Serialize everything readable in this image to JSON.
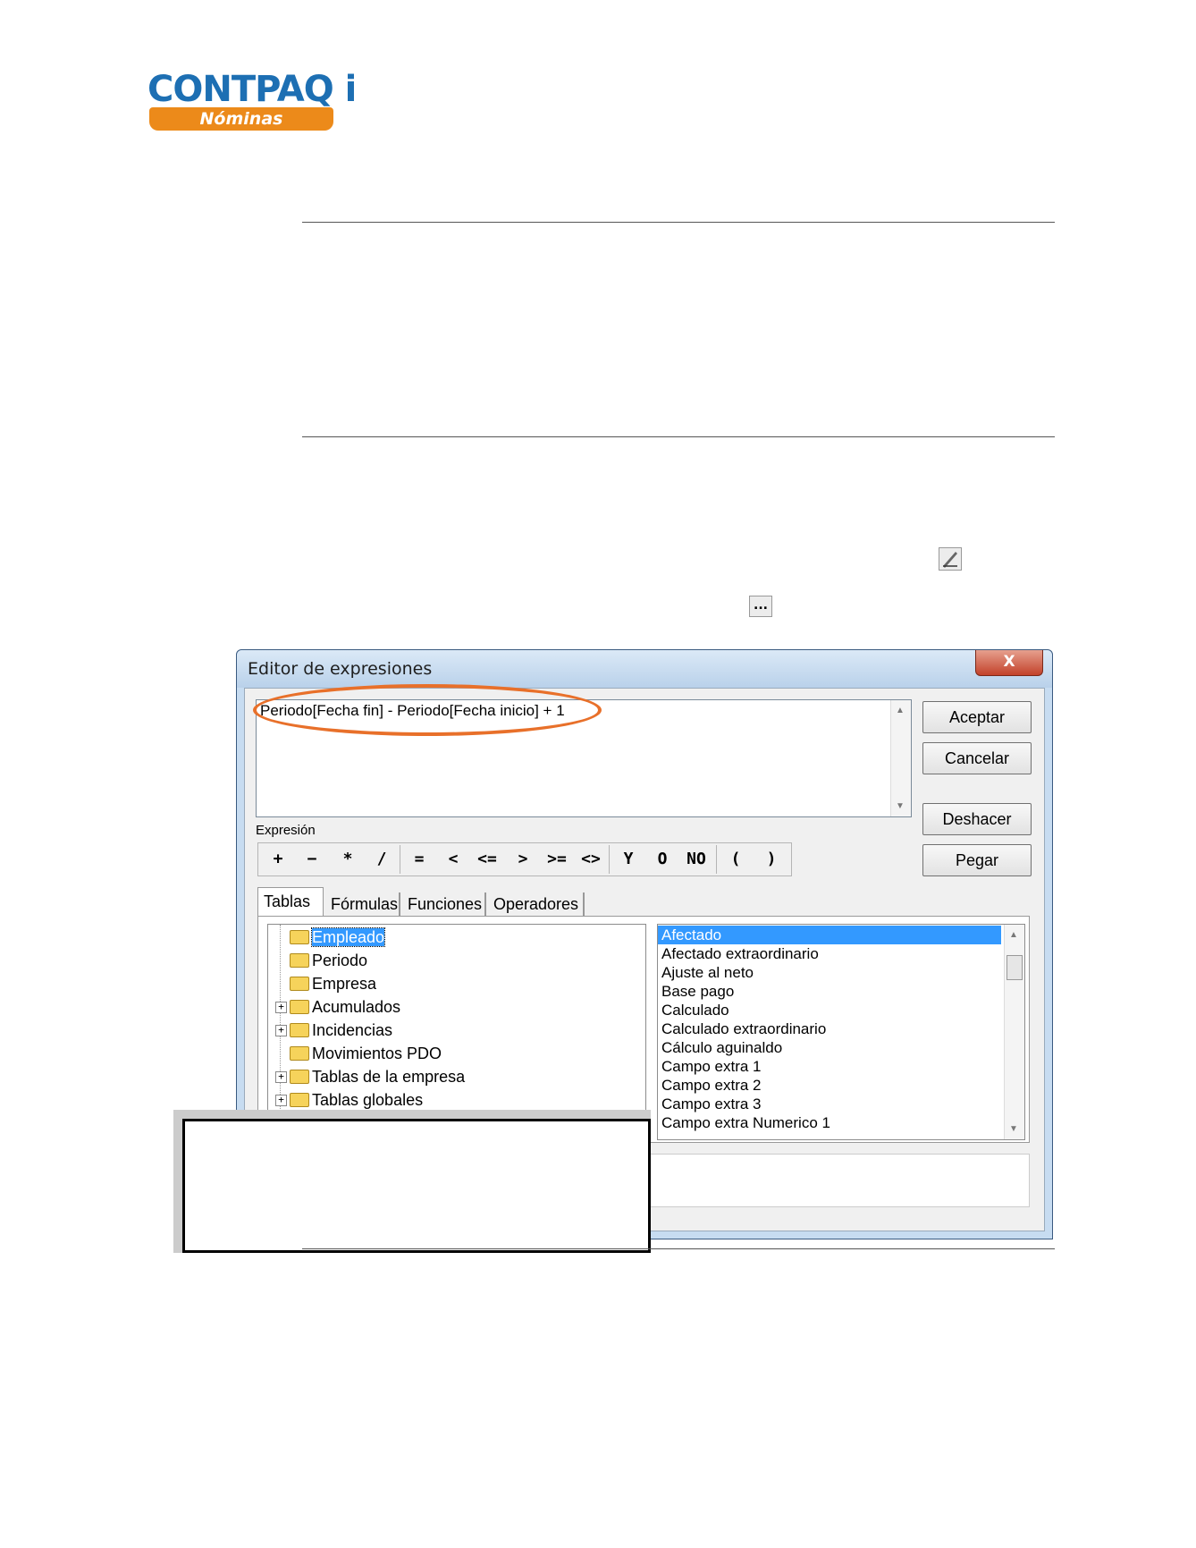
{
  "logo": {
    "word": "CONTPAQ i",
    "badge": "Nóminas"
  },
  "dialog": {
    "title": "Editor de expresiones",
    "close_glyph": "X",
    "expression": "Periodo[Fecha fin] - Periodo[Fecha inicio] + 1",
    "expression_label": "Expresión",
    "buttons": {
      "accept": "Aceptar",
      "cancel": "Cancelar",
      "undo": "Deshacer",
      "paste": "Pegar"
    },
    "operators": [
      "+",
      "−",
      "*",
      "/",
      "=",
      "<",
      "<=",
      ">",
      ">=",
      "<>",
      "Y",
      "O",
      "NO",
      "(",
      ")"
    ],
    "tabs": [
      "Tablas",
      "Fórmulas",
      "Funciones",
      "Operadores"
    ],
    "active_tab": "Tablas",
    "tree": [
      {
        "label": "Empleado",
        "expandable": false,
        "selected": true
      },
      {
        "label": "Periodo",
        "expandable": false
      },
      {
        "label": "Empresa",
        "expandable": false
      },
      {
        "label": "Acumulados",
        "expandable": true
      },
      {
        "label": "Incidencias",
        "expandable": true
      },
      {
        "label": "Movimientos PDO",
        "expandable": false
      },
      {
        "label": "Tablas de la empresa",
        "expandable": true
      },
      {
        "label": "Tablas globales",
        "expandable": true
      }
    ],
    "fields": [
      "Afectado",
      "Afectado extraordinario",
      "Ajuste al neto",
      "Base pago",
      "Calculado",
      "Calculado extraordinario",
      "Cálculo aguinaldo",
      "Campo extra 1",
      "Campo extra 2",
      "Campo extra 3",
      "Campo extra Numerico 1"
    ],
    "selected_field": "Afectado"
  },
  "icons": {
    "edit_icon": "pencil-icon",
    "ellipsis_button": "..."
  }
}
